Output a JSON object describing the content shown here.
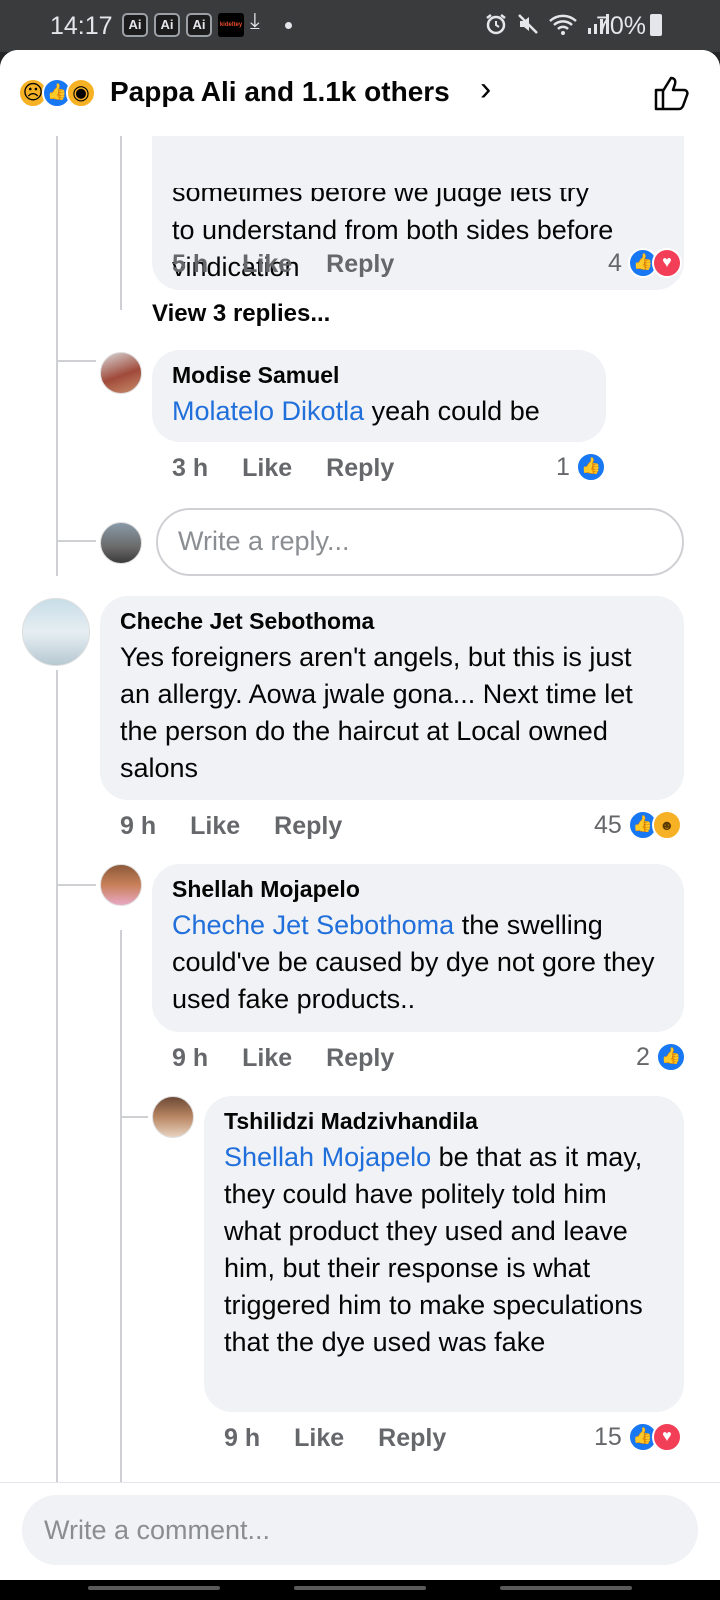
{
  "status_bar": {
    "time": "14:17",
    "notif_ai": [
      "Ai",
      "Ai",
      "Ai"
    ],
    "notif_app": "kideltey",
    "download_glyph": "⤓",
    "battery": "70%",
    "icons": [
      "alarm-icon",
      "mute-icon",
      "wifi-icon",
      "signal-icon",
      "battery-icon"
    ]
  },
  "header": {
    "reaction_icons": [
      "sad-reaction-icon",
      "like-reaction-icon",
      "wow-reaction-icon"
    ],
    "title": "Pappa Ali and 1.1k others",
    "chevron": "›"
  },
  "comments": {
    "c0": {
      "text_partial": "sometimes before we judge lets try",
      "text": "to understand from both sides before vindication",
      "time": "5 h",
      "like": "Like",
      "reply": "Reply",
      "count": "4"
    },
    "view_replies": "View 3 replies...",
    "c1": {
      "author": "Modise Samuel",
      "mention": "Molatelo Dikotla",
      "text": " yeah could be",
      "time": "3 h",
      "like": "Like",
      "reply": "Reply",
      "count": "1"
    },
    "reply_placeholder": "Write a reply...",
    "c2": {
      "author": "Cheche Jet Sebothoma",
      "text": "Yes foreigners aren't angels, but this is just an allergy. Aowa jwale gona... Next time let the person do the haircut at Local owned salons",
      "time": "9 h",
      "like": "Like",
      "reply": "Reply",
      "count": "45"
    },
    "c3": {
      "author": "Shellah Mojapelo",
      "mention": "Cheche Jet Sebothoma",
      "text": " the swelling could've be caused by dye not gore they used fake products..",
      "time": "9 h",
      "like": "Like",
      "reply": "Reply",
      "count": "2"
    },
    "c4": {
      "author": "Tshilidzi Madzivhandila",
      "mention": "Shellah Mojapelo",
      "text": " be that as it may, they could have politely told him what product they used and leave him, but their response is what triggered him to make speculations that the dye used was fake",
      "time": "9 h",
      "like": "Like",
      "reply": "Reply",
      "count": "15"
    }
  },
  "footer": {
    "comment_placeholder": "Write a comment..."
  },
  "colors": {
    "mention": "#216fdb",
    "like_blue": "#1877f2",
    "love_red": "#f33e58",
    "bubble": "#f0f2f5"
  }
}
